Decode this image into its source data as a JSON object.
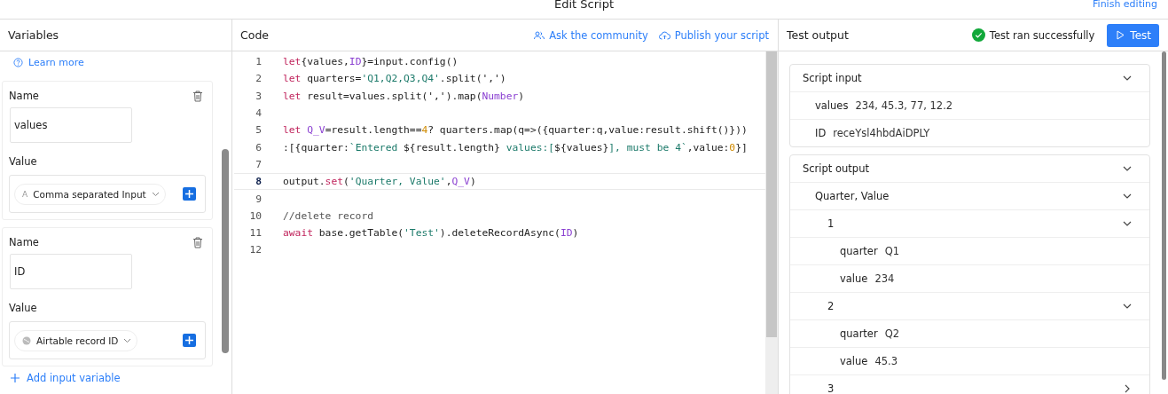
{
  "window": {
    "title": "Edit Script",
    "finish_link": "Finish editing"
  },
  "variables_panel": {
    "title": "Variables",
    "learn_more": "Learn more",
    "add_link": "Add input variable",
    "variables": [
      {
        "name_label": "Name",
        "name": "values",
        "value_label": "Value",
        "value_type": "Comma separated Input",
        "kind": "text",
        "type_glyph": "A"
      },
      {
        "name_label": "Name",
        "name": "ID",
        "value_label": "Value",
        "value_type": "Airtable record ID",
        "kind": "record"
      }
    ]
  },
  "code_panel": {
    "title": "Code",
    "links": [
      {
        "label": "Ask the community",
        "kind": "people"
      },
      {
        "label": "Publish your script",
        "kind": "cloud"
      }
    ],
    "lines": [
      {
        "number": "1",
        "current": false,
        "tokens": [
          {
            "t": "let",
            "kind": "kw"
          },
          {
            "t": "{values,",
            "kind": "plain"
          },
          {
            "t": "ID",
            "kind": "var"
          },
          {
            "t": "}=input.config()",
            "kind": "plain"
          }
        ]
      },
      {
        "number": "2",
        "current": false,
        "tokens": [
          {
            "t": "let",
            "kind": "kw"
          },
          {
            "t": " quarters=",
            "kind": "plain"
          },
          {
            "t": "'Q1,Q2,Q3,Q4'",
            "kind": "str"
          },
          {
            "t": ".split(',')",
            "kind": "plain"
          }
        ]
      },
      {
        "number": "3",
        "current": false,
        "tokens": [
          {
            "t": "let",
            "kind": "kw"
          },
          {
            "t": " result=values.split(',').map(",
            "kind": "plain"
          },
          {
            "t": "Number",
            "kind": "var"
          },
          {
            "t": ")",
            "kind": "plain"
          }
        ]
      },
      {
        "number": "4",
        "current": false
      },
      {
        "number": "5",
        "current": false,
        "tokens": [
          {
            "t": "let ",
            "kind": "kw"
          },
          {
            "t": "Q_V",
            "kind": "var"
          },
          {
            "t": "=result.length==",
            "kind": "plain"
          },
          {
            "t": "4",
            "kind": "num"
          },
          {
            "t": "? quarters.map(q=>({quarter:q,value:result.shift()}))",
            "kind": "plain"
          }
        ]
      },
      {
        "number": "6",
        "current": false,
        "tokens": [
          {
            "t": ":[{quarter:",
            "kind": "plain"
          },
          {
            "t": "`Entered ",
            "kind": "str"
          },
          {
            "t": "${result.length}",
            "kind": "plain"
          },
          {
            "t": " values:[",
            "kind": "str"
          },
          {
            "t": "${values}",
            "kind": "plain"
          },
          {
            "t": "], must be 4`",
            "kind": "str"
          },
          {
            "t": ",value:",
            "kind": "plain"
          },
          {
            "t": "0",
            "kind": "num"
          },
          {
            "t": "}]",
            "kind": "plain"
          }
        ]
      },
      {
        "number": "7",
        "current": false
      },
      {
        "number": "8",
        "current": true,
        "tokens": [
          {
            "t": "output.",
            "kind": "plain"
          },
          {
            "t": "set",
            "kind": "kw"
          },
          {
            "t": "(",
            "kind": "plain"
          },
          {
            "t": "'Quarter, Value'",
            "kind": "str"
          },
          {
            "t": ",",
            "kind": "plain"
          },
          {
            "t": "Q_V",
            "kind": "var"
          },
          {
            "t": ")",
            "kind": "plain"
          }
        ]
      },
      {
        "number": "9",
        "current": false
      },
      {
        "number": "10",
        "current": false,
        "tokens": [
          {
            "t": "//delete record",
            "kind": "comment"
          }
        ]
      },
      {
        "number": "11",
        "current": false,
        "tokens": [
          {
            "t": "await",
            "kind": "kw"
          },
          {
            "t": " base.getTable(",
            "kind": "plain"
          },
          {
            "t": "'Test'",
            "kind": "str"
          },
          {
            "t": ").deleteRecordAsync(",
            "kind": "plain"
          },
          {
            "t": "ID",
            "kind": "var"
          },
          {
            "t": ")",
            "kind": "plain"
          }
        ]
      },
      {
        "number": "12",
        "current": false
      }
    ]
  },
  "test_panel": {
    "title": "Test output",
    "status": "Test ran successfully",
    "test_button": "Test",
    "sections": [
      {
        "label": "Script input",
        "expanded": true,
        "children": [
          {
            "key": "values",
            "value": "234, 45.3, 77, 12.2"
          },
          {
            "key": "ID",
            "value": "receYsl4hbdAiDPLY"
          }
        ]
      },
      {
        "label": "Script output",
        "expanded": true,
        "children": [
          {
            "label": "Quarter, Value",
            "expanded": true,
            "children": [
              {
                "label": "1",
                "expanded": true,
                "children": [
                  {
                    "key": "quarter",
                    "value": "Q1"
                  },
                  {
                    "key": "value",
                    "value": "234"
                  }
                ]
              },
              {
                "label": "2",
                "expanded": true,
                "children": [
                  {
                    "key": "quarter",
                    "value": "Q2"
                  },
                  {
                    "key": "value",
                    "value": "45.3"
                  }
                ]
              },
              {
                "label": "3",
                "expanded": false
              }
            ]
          }
        ]
      }
    ]
  }
}
